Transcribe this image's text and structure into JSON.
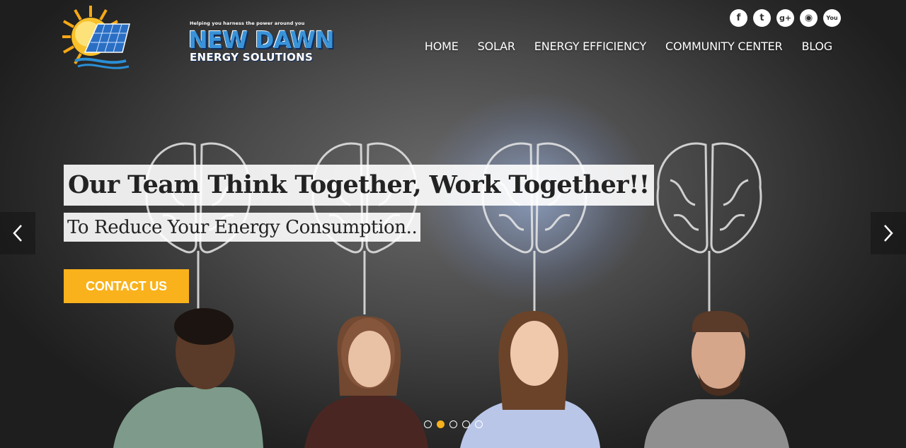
{
  "brand": {
    "tagline": "Helping you harness the power around you",
    "name": "NEW DAWN",
    "subname": "ENERGY SOLUTIONS"
  },
  "social": [
    {
      "name": "facebook-icon",
      "glyph": "f"
    },
    {
      "name": "twitter-icon",
      "glyph": "t"
    },
    {
      "name": "google-plus-icon",
      "glyph": "g+"
    },
    {
      "name": "rss-icon",
      "glyph": "◉"
    },
    {
      "name": "youtube-icon",
      "glyph": "You"
    }
  ],
  "nav": [
    "HOME",
    "SOLAR",
    "ENERGY EFFICIENCY",
    "COMMUNITY CENTER",
    "BLOG"
  ],
  "slide": {
    "headline": "Our Team Think Together, Work Together!!",
    "subline": "To Reduce Your Energy Consumption..",
    "cta": "CONTACT US"
  },
  "slider": {
    "total_slides": 5,
    "active_index": 1
  },
  "colors": {
    "accent": "#f9b21b",
    "logo_blue": "#3a93d8",
    "text_dark": "#222222"
  }
}
